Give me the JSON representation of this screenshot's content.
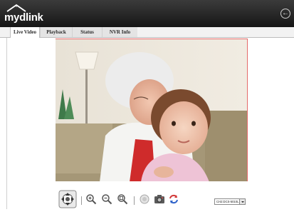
{
  "app": {
    "logo_text_my": "my",
    "logo_text_dlink": "dlink"
  },
  "tabs": [
    {
      "label": "Live Video",
      "active": true
    },
    {
      "label": "Playback",
      "active": false
    },
    {
      "label": "Status",
      "active": false
    },
    {
      "label": "NVR Info",
      "active": false
    }
  ],
  "toolbar": {
    "icons": [
      "ptz-control-icon",
      "zoom-in-icon",
      "zoom-out-icon",
      "zoom-reset-icon",
      "record-icon",
      "snapshot-icon",
      "refresh-icon"
    ]
  },
  "channel_select": {
    "selected": "CH2:DCS-5010L"
  },
  "colors": {
    "topbar": "#1c1c1c",
    "accent": "#e46a6a"
  }
}
